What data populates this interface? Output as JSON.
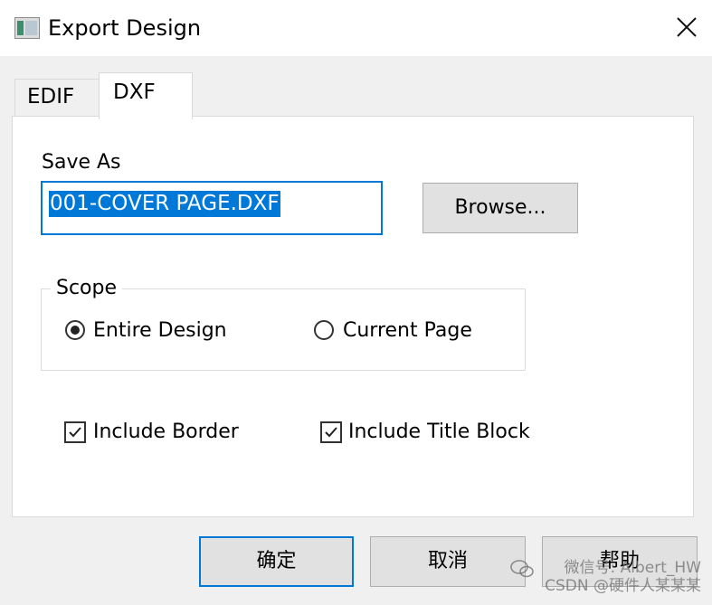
{
  "window": {
    "title": "Export Design",
    "icon": "app-window-icon",
    "close_icon": "close-icon"
  },
  "tabs": [
    {
      "label": "EDIF",
      "active": false
    },
    {
      "label": "DXF",
      "active": true
    }
  ],
  "save_as": {
    "label": "Save As",
    "value": "001-COVER PAGE.DXF",
    "browse_label": "Browse..."
  },
  "scope": {
    "title": "Scope",
    "options": [
      {
        "label": "Entire Design",
        "selected": true
      },
      {
        "label": "Current Page",
        "selected": false
      }
    ]
  },
  "options": {
    "include_border": {
      "label": "Include Border",
      "checked": true
    },
    "include_title_block": {
      "label": "Include Title Block",
      "checked": true
    }
  },
  "footer": {
    "ok_label": "确定",
    "cancel_label": "取消",
    "help_label": "帮助"
  },
  "watermark": {
    "line1": "微信号: Albert_HW",
    "line2": "CSDN @硬件人某某某"
  },
  "colors": {
    "accent": "#0078d7",
    "button_face": "#e1e1e1",
    "dialog_bg": "#f0f0f0"
  }
}
